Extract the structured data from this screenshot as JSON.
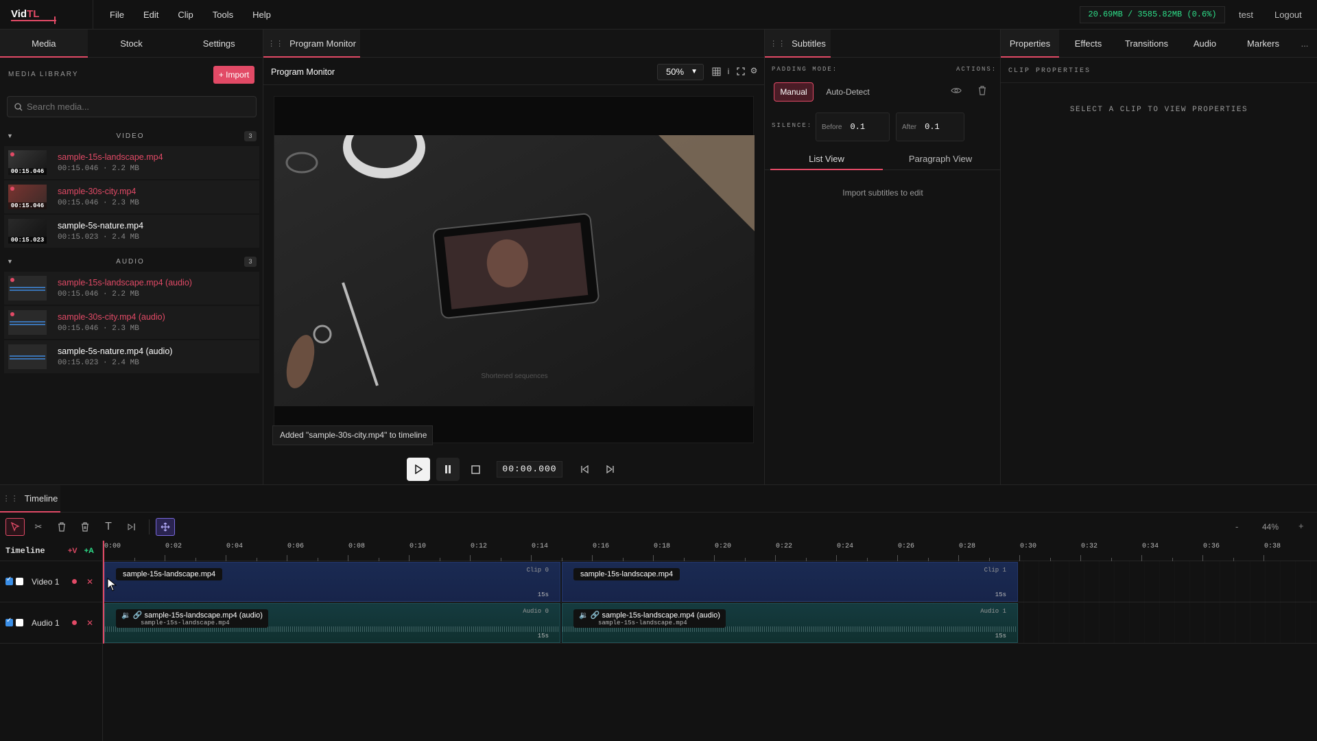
{
  "app": {
    "logo_main": "Vid",
    "logo_accent": "TL"
  },
  "menu": [
    "File",
    "Edit",
    "Clip",
    "Tools",
    "Help"
  ],
  "memory": "20.69MB / 3585.82MB (0.6%)",
  "user": "test",
  "logout": "Logout",
  "left_tabs": [
    "Media",
    "Stock",
    "Settings"
  ],
  "media_library": {
    "title": "MEDIA LIBRARY",
    "import_label": "+ Import",
    "search_placeholder": "Search media...",
    "video_group": {
      "label": "VIDEO",
      "count": "3",
      "items": [
        {
          "name": "sample-15s-landscape.mp4",
          "meta": "00:15.046 · 2.2 MB",
          "dur": "00:15.046",
          "highlight": true
        },
        {
          "name": "sample-30s-city.mp4",
          "meta": "00:15.046 · 2.3 MB",
          "dur": "00:15.046",
          "highlight": true
        },
        {
          "name": "sample-5s-nature.mp4",
          "meta": "00:15.023 · 2.4 MB",
          "dur": "00:15.023",
          "highlight": false
        }
      ]
    },
    "audio_group": {
      "label": "AUDIO",
      "count": "3",
      "items": [
        {
          "name": "sample-15s-landscape.mp4 (audio)",
          "meta": "00:15.046 · 2.2 MB",
          "highlight": true
        },
        {
          "name": "sample-30s-city.mp4 (audio)",
          "meta": "00:15.046 · 2.3 MB",
          "highlight": true
        },
        {
          "name": "sample-5s-nature.mp4 (audio)",
          "meta": "00:15.023 · 2.4 MB",
          "highlight": false
        }
      ]
    }
  },
  "program_monitor": {
    "tab": "Program Monitor",
    "title": "Program Monitor",
    "zoom": "50%",
    "toast": "Added \"sample-30s-city.mp4\" to timeline",
    "timecode": "00:00.000",
    "screen_caption": "Shortened sequences"
  },
  "subtitles": {
    "tab": "Subtitles",
    "padding_mode_label": "PADDING MODE:",
    "actions_label": "ACTIONS:",
    "manual": "Manual",
    "auto_detect": "Auto-Detect",
    "silence_label": "SILENCE:",
    "before_label": "Before",
    "before_value": "0.1",
    "after_label": "After",
    "after_value": "0.1",
    "list_view": "List View",
    "paragraph_view": "Paragraph View",
    "empty": "Import subtitles to edit"
  },
  "right_tabs": [
    "Properties",
    "Effects",
    "Transitions",
    "Audio",
    "Markers"
  ],
  "right_more": "...",
  "clip_properties": {
    "title": "CLIP PROPERTIES",
    "empty": "SELECT A CLIP TO VIEW PROPERTIES"
  },
  "timeline": {
    "tab": "Timeline",
    "label": "Timeline",
    "add_video": "+V",
    "add_audio": "+A",
    "zoom": "44%",
    "zoom_minus": "-",
    "zoom_plus": "+",
    "ruler": [
      "0:00",
      "0:02",
      "0:04",
      "0:06",
      "0:08",
      "0:10",
      "0:12",
      "0:14",
      "0:16",
      "0:18",
      "0:20",
      "0:22",
      "0:24",
      "0:26",
      "0:28",
      "0:30",
      "0:32",
      "0:34",
      "0:36",
      "0:38"
    ],
    "tracks": [
      {
        "name": "Video 1"
      },
      {
        "name": "Audio 1"
      }
    ],
    "clips": {
      "v0": {
        "name": "sample-15s-landscape.mp4",
        "tag": "Clip 0",
        "len": "15s"
      },
      "v1": {
        "name": "sample-15s-landscape.mp4",
        "tag": "Clip 1",
        "len": "15s"
      },
      "a0": {
        "name": "sample-15s-landscape.mp4 (audio)",
        "sub": "sample-15s-landscape.mp4",
        "tag": "Audio 0",
        "len": "15s"
      },
      "a1": {
        "name": "sample-15s-landscape.mp4 (audio)",
        "sub": "sample-15s-landscape.mp4",
        "tag": "Audio 1",
        "len": "15s"
      }
    }
  },
  "colors": {
    "accent": "#e24a66",
    "memory_green": "#2ee08a",
    "video_clip": "#1a2a52",
    "audio_clip": "#153b3f"
  }
}
